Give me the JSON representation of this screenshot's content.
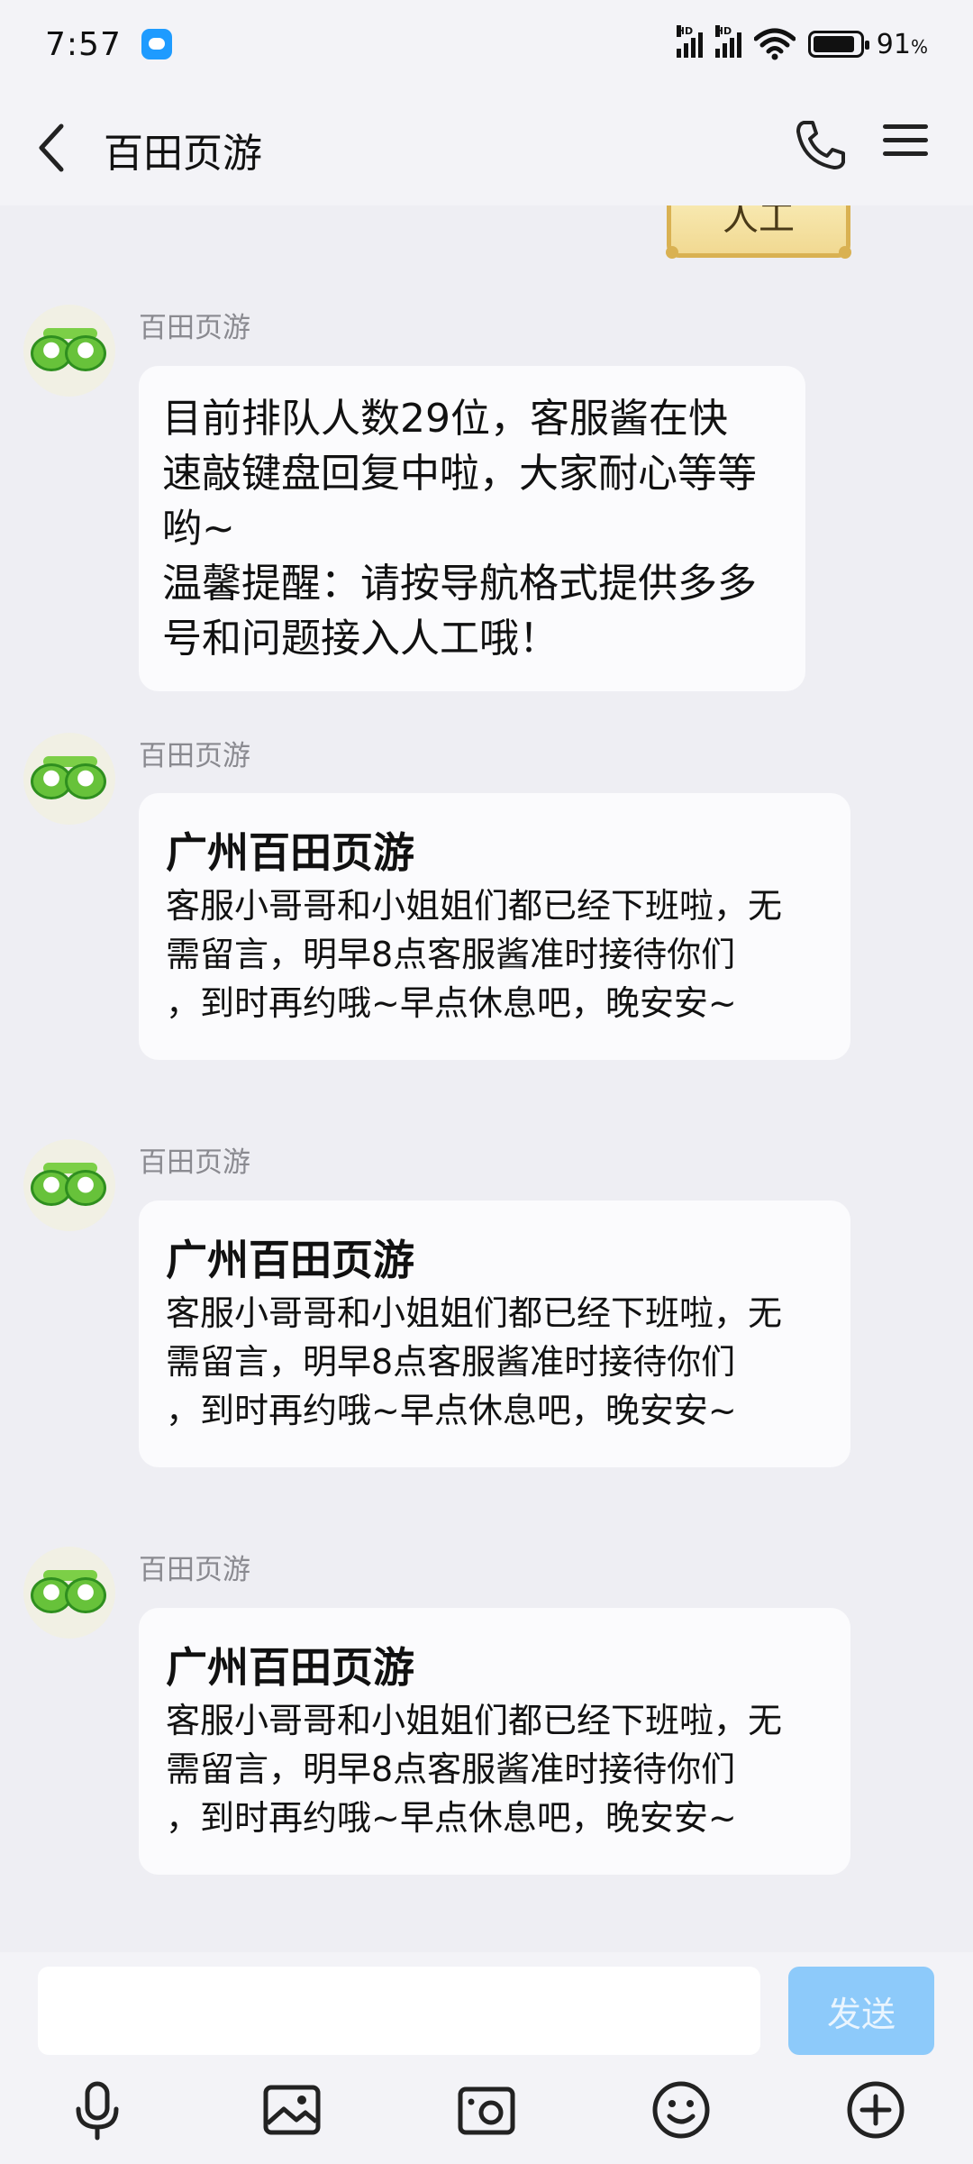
{
  "status_bar": {
    "time": "7:57",
    "signal_label": "HD",
    "battery": "91",
    "battery_unit": "%"
  },
  "header": {
    "title": "百田页游"
  },
  "previous_message": {
    "text": "人工"
  },
  "messages": [
    {
      "sender": "百田页游",
      "text": "目前排队人数29位，客服酱在快\n速敲键盘回复中啦，大家耐心等等\n哟~\n温馨提醒：请按导航格式提供多多\n号和问题接入人工哦！"
    },
    {
      "sender": "百田页游",
      "title": "广州百田页游",
      "body": "客服小哥哥和小姐姐们都已经下班啦，无\n需留言，明早8点客服酱准时接待你们\n，到时再约哦~早点休息吧，晚安安~"
    },
    {
      "sender": "百田页游",
      "title": "广州百田页游",
      "body": "客服小哥哥和小姐姐们都已经下班啦，无\n需留言，明早8点客服酱准时接待你们\n，到时再约哦~早点休息吧，晚安安~"
    },
    {
      "sender": "百田页游",
      "title": "广州百田页游",
      "body": "客服小哥哥和小姐姐们都已经下班啦，无\n需留言，明早8点客服酱准时接待你们\n，到时再约哦~早点休息吧，晚安安~"
    }
  ],
  "input": {
    "value": "",
    "placeholder": "",
    "send_label": "发送"
  },
  "toolbar": {
    "icons": [
      "microphone-icon",
      "image-icon",
      "camera-icon",
      "emoji-icon",
      "plus-icon"
    ]
  },
  "colors": {
    "background": "#eeeef3",
    "send_button": "#8dcafa",
    "bubble": "#fbfbfd"
  }
}
